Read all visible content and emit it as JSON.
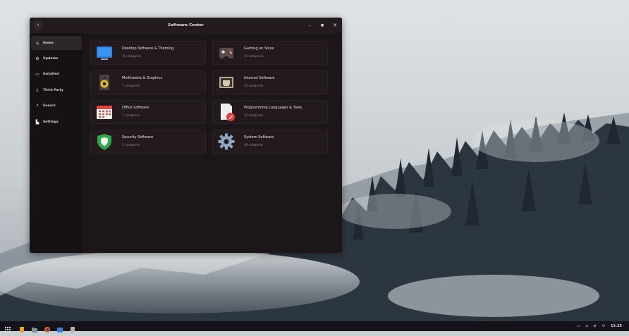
{
  "window": {
    "title": "Software Center",
    "back_icon": "back-arrow-icon",
    "controls": {
      "minimize": "–",
      "maximize": "●",
      "close": "✕"
    }
  },
  "sidebar": {
    "items": [
      {
        "label": "Home",
        "icon": "home-icon",
        "glyph": "⌂",
        "active": true
      },
      {
        "label": "Updates",
        "icon": "updates-icon",
        "glyph": "⚙"
      },
      {
        "label": "Installed",
        "icon": "installed-icon",
        "glyph": "▭"
      },
      {
        "label": "Third Party",
        "icon": "third-party-icon",
        "glyph": "⤓"
      },
      {
        "label": "Search",
        "icon": "search-icon",
        "glyph": "⌕"
      },
      {
        "label": "Settings",
        "icon": "settings-icon",
        "glyph": "▙"
      }
    ]
  },
  "categories": [
    {
      "title": "Desktop Software & Theming",
      "subtitle": "11 categories",
      "icon": "desktop-icon"
    },
    {
      "title": "Gaming on Solus",
      "subtitle": "10 categories",
      "icon": "gamepad-icon"
    },
    {
      "title": "Multimedia & Graphics",
      "subtitle": "7 categories",
      "icon": "speaker-icon"
    },
    {
      "title": "Internet Software",
      "subtitle": "10 categories",
      "icon": "network-icon"
    },
    {
      "title": "Office Software",
      "subtitle": "7 categories",
      "icon": "calendar-icon"
    },
    {
      "title": "Programming Languages & Tools",
      "subtitle": "10 categories",
      "icon": "document-edit-icon"
    },
    {
      "title": "Security Software",
      "subtitle": "3 categories",
      "icon": "shield-icon"
    },
    {
      "title": "System Software",
      "subtitle": "18 categories",
      "icon": "gear-icon"
    }
  ],
  "taskbar": {
    "apps": [
      "apps-grid-icon",
      "files-icon",
      "folder-icon",
      "firefox-icon",
      "software-center-icon",
      "terminal-icon"
    ],
    "tray": {
      "icons": [
        "window-icon",
        "network-icon",
        "volume-icon",
        "power-icon"
      ],
      "clock": "15:23"
    }
  },
  "colors": {
    "window_bg": "#1d1618",
    "sidebar_bg": "#161113",
    "card_bg": "#221a1c",
    "active_item": "#2e2729"
  }
}
